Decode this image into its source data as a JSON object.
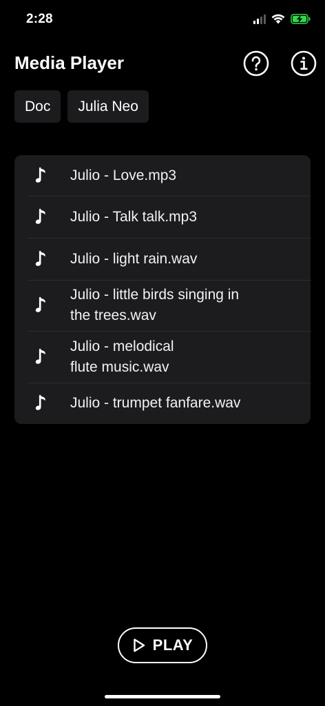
{
  "status_bar": {
    "time": "2:28",
    "signal_icon": "cellular-signal-icon",
    "wifi_icon": "wifi-icon",
    "battery_icon": "battery-charging-icon",
    "battery_color": "#32d74b"
  },
  "header": {
    "title": "Media Player",
    "help_icon": "question-circle-icon",
    "info_icon": "info-circle-icon"
  },
  "chips": [
    {
      "label": "Doc"
    },
    {
      "label": "Julia Neo"
    }
  ],
  "files": [
    {
      "icon": "music-note-icon",
      "line1": "Julio - Love.mp3",
      "line2": ""
    },
    {
      "icon": "music-note-icon",
      "line1": "Julio - Talk talk.mp3",
      "line2": ""
    },
    {
      "icon": "music-note-icon",
      "line1": "Julio - light rain.wav",
      "line2": ""
    },
    {
      "icon": "music-note-icon",
      "line1": "Julio - little birds singing in",
      "line2": "the trees.wav"
    },
    {
      "icon": "music-note-icon",
      "line1": "Julio - melodical",
      "line2": "flute music.wav"
    },
    {
      "icon": "music-note-icon",
      "line1": "Julio - trumpet fanfare.wav",
      "line2": ""
    }
  ],
  "player": {
    "play_label": "PLAY",
    "play_icon": "play-triangle-icon"
  },
  "colors": {
    "background": "#000000",
    "surface": "#1c1c1e",
    "separator": "#2e2e30",
    "text": "#ffffff"
  }
}
